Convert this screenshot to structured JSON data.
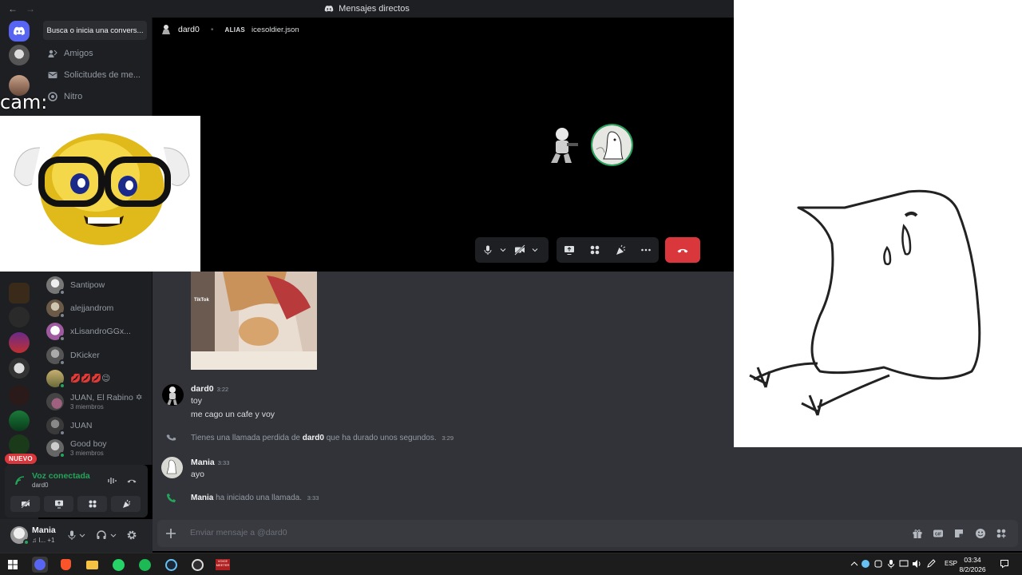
{
  "window": {
    "title": "Mensajes directos",
    "back_arrow": "←",
    "forward_arrow": "→"
  },
  "sidebar": {
    "search_placeholder": "Busca o inicia una convers...",
    "nav": [
      {
        "label": "Amigos",
        "icon": "friends-icon"
      },
      {
        "label": "Solicitudes de me...",
        "icon": "mail-icon"
      },
      {
        "label": "Nitro",
        "icon": "nitro-icon"
      }
    ],
    "dms": [
      {
        "name": "Santipow",
        "sub": "",
        "status": "offline"
      },
      {
        "name": "alejjandrom",
        "sub": "",
        "status": "offline"
      },
      {
        "name": "xLisandroGGx...",
        "sub": "",
        "status": "offline"
      },
      {
        "name": "DKicker",
        "sub": "",
        "status": "offline"
      },
      {
        "name": "💋💋💋😉",
        "sub": "",
        "status": "online"
      },
      {
        "name": "JUAN, El Rabino ✡",
        "sub": "3 miembros",
        "status": "group"
      },
      {
        "name": "JUAN",
        "sub": "",
        "status": "offline"
      },
      {
        "name": "Good boy",
        "sub": "3 miembros",
        "status": "group"
      }
    ]
  },
  "rail": {
    "new_badge": "NUEVO"
  },
  "voice_panel": {
    "status": "Voz conectada",
    "user": "dard0"
  },
  "user_panel": {
    "name": "Mania",
    "status": "♫ I... +1"
  },
  "call": {
    "recipient": "dard0",
    "alias_label": "ALIAS",
    "alias_value": "icesoldier.json"
  },
  "chat": {
    "gif_watermark": "TikTok",
    "messages": [
      {
        "author": "dard0",
        "time": "3:22",
        "lines": [
          "toy",
          "me cago un cafe y voy"
        ]
      },
      {
        "author": "Mania",
        "time": "3:33",
        "lines": [
          "ayo"
        ]
      }
    ],
    "system_missed": {
      "prefix": "Tienes una llamada perdida de",
      "user": "dard0",
      "suffix": "que ha durado unos segundos.",
      "time": "3:29"
    },
    "system_started": {
      "user": "Mania",
      "text": "ha iniciado una llamada.",
      "time": "3:33"
    },
    "input_placeholder": "Enviar mensaje a @dard0"
  },
  "overlay": {
    "cam_label": "cam:"
  },
  "taskbar": {
    "lang": "ESP",
    "time": "03:34",
    "date": "8/2/2026",
    "voicemeeter_label": "VOICE MEETER"
  },
  "colors": {
    "accent": "#5865f2",
    "danger": "#da373c",
    "online": "#23a55a"
  }
}
